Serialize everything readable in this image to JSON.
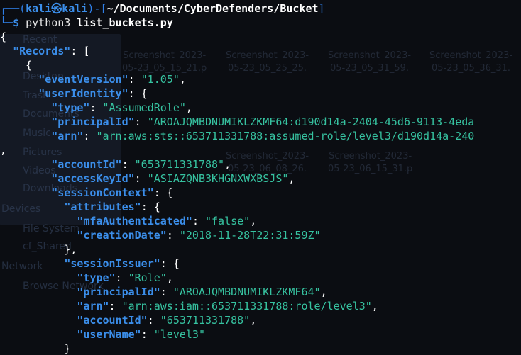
{
  "prompt": {
    "prefix": "┌──(",
    "user": "kali",
    "at": "㉿",
    "host": "kali",
    "mid": ")-[",
    "path": "~/Documents/CyberDefenders/Bucket",
    "close": "]",
    "second_prefix": "└─",
    "dollar": "$",
    "command_bin": "python3",
    "command_arg": "list_buckets.py"
  },
  "background": {
    "sidebar_items": [
      "Recent",
      "Desktop",
      "Trash",
      "Documents",
      "Music",
      "Pictures",
      "Videos",
      "Downloads",
      "Devices",
      "File System",
      "cf_Shared",
      "Network",
      "Browse Network"
    ],
    "thumbnails": [
      {
        "line1": "Screenshot_2023-",
        "line2": "05-23_05_15_21.p"
      },
      {
        "line1": "Screenshot_2023-",
        "line2": "05-23_05_25_25."
      },
      {
        "line1": "Screenshot_2023-",
        "line2": "05-23_05_31_59."
      },
      {
        "line1": "Screenshot_2023-",
        "line2": "05-23_05_36_31."
      },
      {
        "line1": "Screenshot_2023-",
        "line2": "05-23_06_08_26."
      },
      {
        "line1": "Screenshot_2023-",
        "line2": "05-23_06_15_31.p"
      }
    ]
  },
  "output_lines": [
    [
      {
        "c": "pn",
        "t": "{"
      }
    ],
    [
      {
        "c": "pn",
        "t": "  "
      },
      {
        "c": "key",
        "t": "\"Records\""
      },
      {
        "c": "pn",
        "t": ": ["
      }
    ],
    [
      {
        "c": "pn",
        "t": "    {"
      }
    ],
    [
      {
        "c": "pn",
        "t": "      "
      },
      {
        "c": "key",
        "t": "\"eventVersion\""
      },
      {
        "c": "pn",
        "t": ": "
      },
      {
        "c": "str",
        "t": "\"1.05\""
      },
      {
        "c": "pn",
        "t": ","
      }
    ],
    [
      {
        "c": "pn",
        "t": "      "
      },
      {
        "c": "key",
        "t": "\"userIdentity\""
      },
      {
        "c": "pn",
        "t": ": {"
      }
    ],
    [
      {
        "c": "pn",
        "t": "        "
      },
      {
        "c": "key",
        "t": "\"type\""
      },
      {
        "c": "pn",
        "t": ": "
      },
      {
        "c": "str",
        "t": "\"AssumedRole\""
      },
      {
        "c": "pn",
        "t": ","
      }
    ],
    [
      {
        "c": "pn",
        "t": "        "
      },
      {
        "c": "key",
        "t": "\"principalId\""
      },
      {
        "c": "pn",
        "t": ": "
      },
      {
        "c": "str",
        "t": "\"AROAJQMBDNUMIKLZKMF64:d190d14a-2404-45d6-9113-4eda"
      }
    ],
    [
      {
        "c": "pn",
        "t": "        "
      },
      {
        "c": "key",
        "t": "\"arn\""
      },
      {
        "c": "pn",
        "t": ": "
      },
      {
        "c": "str",
        "t": "\"arn:aws:sts::653711331788:assumed-role/level3/d190d14a-240"
      }
    ],
    [
      {
        "c": "pn",
        "t": ","
      }
    ],
    [
      {
        "c": "pn",
        "t": "        "
      },
      {
        "c": "key",
        "t": "\"accountId\""
      },
      {
        "c": "pn",
        "t": ": "
      },
      {
        "c": "str",
        "t": "\"653711331788\""
      },
      {
        "c": "pn",
        "t": ","
      }
    ],
    [
      {
        "c": "pn",
        "t": "        "
      },
      {
        "c": "key",
        "t": "\"accessKeyId\""
      },
      {
        "c": "pn",
        "t": ": "
      },
      {
        "c": "str",
        "t": "\"ASIAZQNB3KHGNXWXBSJS\""
      },
      {
        "c": "pn",
        "t": ","
      }
    ],
    [
      {
        "c": "pn",
        "t": "        "
      },
      {
        "c": "key",
        "t": "\"sessionContext\""
      },
      {
        "c": "pn",
        "t": ": {"
      }
    ],
    [
      {
        "c": "pn",
        "t": "          "
      },
      {
        "c": "key",
        "t": "\"attributes\""
      },
      {
        "c": "pn",
        "t": ": {"
      }
    ],
    [
      {
        "c": "pn",
        "t": "            "
      },
      {
        "c": "key",
        "t": "\"mfaAuthenticated\""
      },
      {
        "c": "pn",
        "t": ": "
      },
      {
        "c": "str",
        "t": "\"false\""
      },
      {
        "c": "pn",
        "t": ","
      }
    ],
    [
      {
        "c": "pn",
        "t": "            "
      },
      {
        "c": "key",
        "t": "\"creationDate\""
      },
      {
        "c": "pn",
        "t": ": "
      },
      {
        "c": "str",
        "t": "\"2018-11-28T22:31:59Z\""
      }
    ],
    [
      {
        "c": "pn",
        "t": "          },"
      }
    ],
    [
      {
        "c": "pn",
        "t": "          "
      },
      {
        "c": "key",
        "t": "\"sessionIssuer\""
      },
      {
        "c": "pn",
        "t": ": {"
      }
    ],
    [
      {
        "c": "pn",
        "t": "            "
      },
      {
        "c": "key",
        "t": "\"type\""
      },
      {
        "c": "pn",
        "t": ": "
      },
      {
        "c": "str",
        "t": "\"Role\""
      },
      {
        "c": "pn",
        "t": ","
      }
    ],
    [
      {
        "c": "pn",
        "t": "            "
      },
      {
        "c": "key",
        "t": "\"principalId\""
      },
      {
        "c": "pn",
        "t": ": "
      },
      {
        "c": "str",
        "t": "\"AROAJQMBDNUMIKLZKMF64\""
      },
      {
        "c": "pn",
        "t": ","
      }
    ],
    [
      {
        "c": "pn",
        "t": "            "
      },
      {
        "c": "key",
        "t": "\"arn\""
      },
      {
        "c": "pn",
        "t": ": "
      },
      {
        "c": "str",
        "t": "\"arn:aws:iam::653711331788:role/level3\""
      },
      {
        "c": "pn",
        "t": ","
      }
    ],
    [
      {
        "c": "pn",
        "t": "            "
      },
      {
        "c": "key",
        "t": "\"accountId\""
      },
      {
        "c": "pn",
        "t": ": "
      },
      {
        "c": "str",
        "t": "\"653711331788\""
      },
      {
        "c": "pn",
        "t": ","
      }
    ],
    [
      {
        "c": "pn",
        "t": "            "
      },
      {
        "c": "key",
        "t": "\"userName\""
      },
      {
        "c": "pn",
        "t": ": "
      },
      {
        "c": "str",
        "t": "\"level3\""
      }
    ],
    [
      {
        "c": "pn",
        "t": "          }"
      }
    ]
  ],
  "colors": {
    "background": "#0b0d12",
    "key": "#3b8eea",
    "string": "#36c2a0",
    "punct": "#ffffff",
    "prompt": "#2f7fe8"
  }
}
